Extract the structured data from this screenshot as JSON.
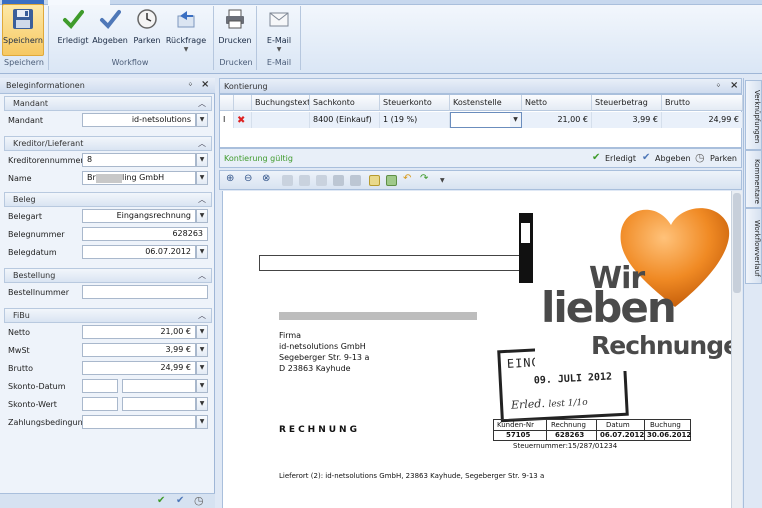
{
  "ribbon": {
    "buttons": {
      "save": "Speichern",
      "done": "Erledigt",
      "hand_over": "Abgeben",
      "park": "Parken",
      "query": "Rückfrage",
      "print": "Drucken",
      "email": "E-Mail"
    },
    "groups": {
      "save": "Speichern",
      "workflow": "Workflow",
      "print": "Drucken",
      "email": "E-Mail"
    }
  },
  "left_panel": {
    "title": "Beleginformationen",
    "pin": "←",
    "close": "×",
    "sections": {
      "mandant": "Mandant",
      "kreditor": "Kreditor/Lieferant",
      "beleg": "Beleg",
      "bestellung": "Bestellung",
      "fibu": "FiBu"
    },
    "fields": {
      "mandant_label": "Mandant",
      "mandant_value": "id-netsolutions",
      "kreditornummer_label": "Kreditorennummer",
      "kreditornummer_value": "8",
      "name_label": "Name",
      "name_value": "Br          Recycling GmbH",
      "belegart_label": "Belegart",
      "belegart_value": "Eingangsrechnung",
      "belegnummer_label": "Belegnummer",
      "belegnummer_value": "628263",
      "belegdatum_label": "Belegdatum",
      "belegdatum_value": "06.07.2012",
      "bestellnummer_label": "Bestellnummer",
      "bestellnummer_value": "",
      "netto_label": "Netto",
      "netto_value": "21,00 €",
      "mwst_label": "MwSt",
      "mwst_value": "3,99 €",
      "brutto_label": "Brutto",
      "brutto_value": "24,99 €",
      "skonto_datum_label": "Skonto-Datum",
      "skonto_wert_label": "Skonto-Wert",
      "zahlungsbedingung_label": "Zahlungsbedingung"
    }
  },
  "kontierung": {
    "title": "Kontierung",
    "columns": [
      "Buchungstext",
      "Sachkonto",
      "Steuerkonto",
      "Kostenstelle",
      "Netto",
      "Steuerbetrag",
      "Brutto"
    ],
    "row": {
      "marker": "I",
      "buchungstext": "",
      "sachkonto": "8400 (Einkauf)",
      "steuerkonto": "1 (19 %)",
      "kostenstelle": "",
      "netto": "21,00 €",
      "steuerbetrag": "3,99 €",
      "brutto": "24,99 €"
    },
    "status": "Kontierung gültig",
    "actions": {
      "done": "Erledigt",
      "hand_over": "Abgeben",
      "park": "Parken"
    }
  },
  "side_tabs": [
    "Verknüpfungen",
    "Kommentare",
    "Workflowverlauf"
  ],
  "document": {
    "sender_lines": [
      "Firma",
      "id-netsolutions GmbH",
      "Segeberger Str. 9-13 a",
      "D  23863 Kayhude"
    ],
    "heading": "RECHNUNG",
    "stamp_text": "EING",
    "stamp_date": "09. JULI 2012",
    "stamp_handwriting": "Erled. [handwritten]",
    "table_headers": [
      "Kunden-Nr",
      "Rechnung",
      "Datum",
      "Buchung"
    ],
    "table_values": [
      "57105",
      "628263",
      "06.07.2012",
      "30.06.2012"
    ],
    "tax_number": "Steuernummer:15/287/01234",
    "delivery_address": "Lieferort (2): id-netsolutions GmbH, 23863 Kayhude, Segeberger Str. 9-13 a",
    "logo_line1": "Wir",
    "logo_line2": "lieben",
    "logo_line3": "Rechnungen!"
  },
  "colors": {
    "ribbon_bg": "#dae6f5",
    "panel_bg": "#eef3fa",
    "accent_green": "#3f9b2c",
    "heart_orange": "#f08a24",
    "logo_gray": "#4a4a4a"
  }
}
